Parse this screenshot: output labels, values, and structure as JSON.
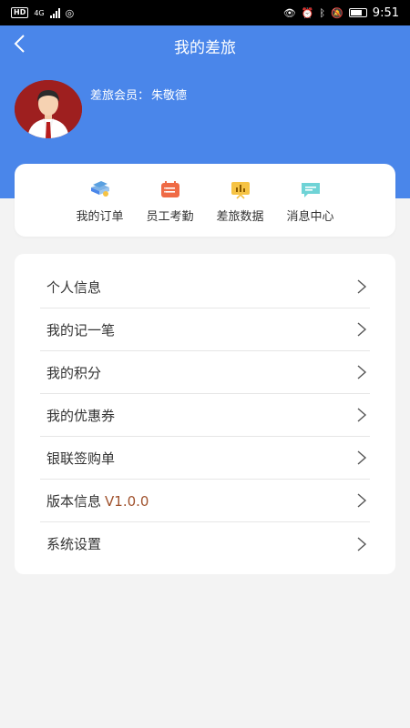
{
  "status_bar": {
    "left_badges": [
      "HD",
      "4G"
    ],
    "time": "9:51"
  },
  "header": {
    "title": "我的差旅",
    "member_label": "差旅会员：",
    "member_name": "朱敬德",
    "background_color": "#4a86ea"
  },
  "quick_actions": [
    {
      "label": "我的订单",
      "icon": "book-stack-icon"
    },
    {
      "label": "员工考勤",
      "icon": "calendar-icon"
    },
    {
      "label": "差旅数据",
      "icon": "chart-board-icon"
    },
    {
      "label": "消息中心",
      "icon": "chat-bubble-icon"
    }
  ],
  "menu": {
    "items": [
      {
        "label": "个人信息"
      },
      {
        "label": "我的记一笔"
      },
      {
        "label": "我的积分"
      },
      {
        "label": "我的优惠券"
      },
      {
        "label": "银联签购单"
      },
      {
        "label": "版本信息",
        "version": "V1.0.0"
      },
      {
        "label": "系统设置"
      }
    ]
  }
}
